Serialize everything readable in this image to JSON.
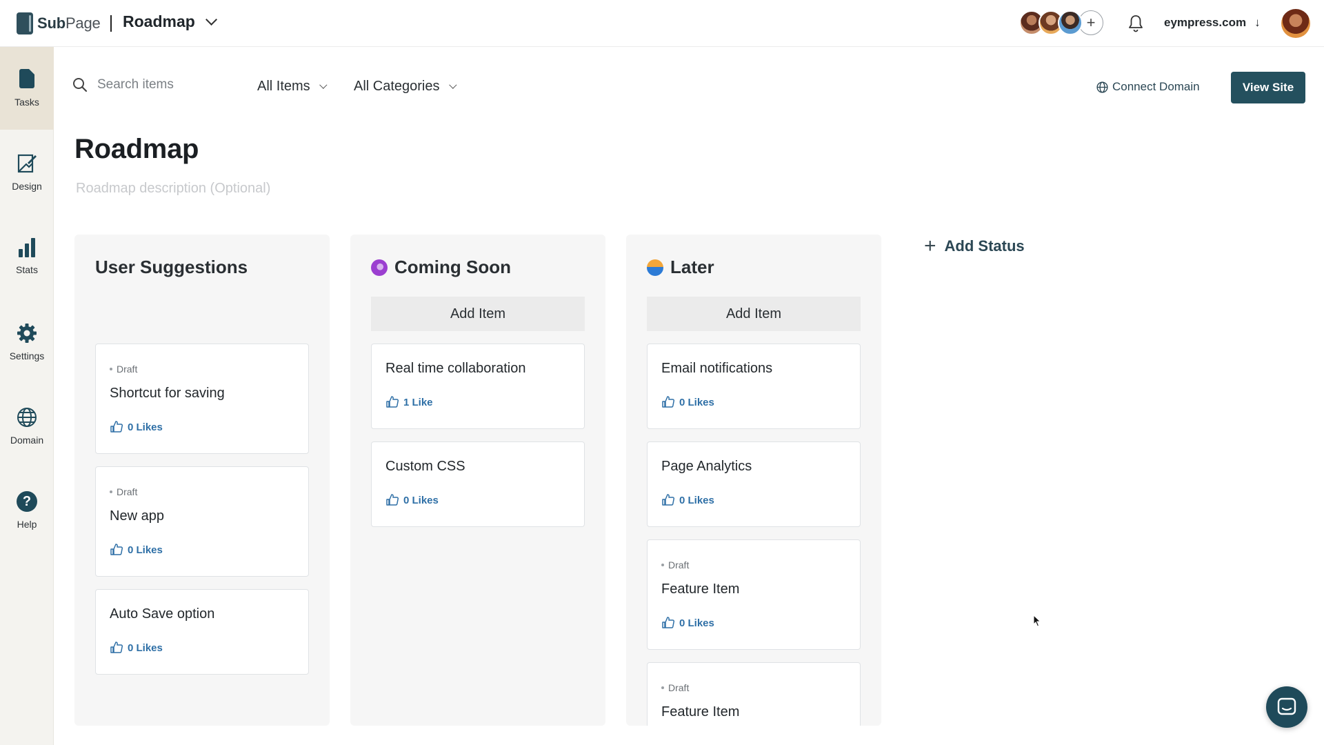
{
  "brand": {
    "name_bold": "Sub",
    "name_rest": "Page"
  },
  "header": {
    "current_page": "Roadmap",
    "domain": "eympress.com",
    "add_member": "+"
  },
  "sidebar": {
    "items": [
      {
        "label": "Tasks",
        "icon": "document-icon",
        "active": true
      },
      {
        "label": "Design",
        "icon": "design-icon"
      },
      {
        "label": "Stats",
        "icon": "stats-icon"
      },
      {
        "label": "Settings",
        "icon": "gear-icon"
      },
      {
        "label": "Domain",
        "icon": "globe-icon"
      },
      {
        "label": "Help",
        "icon": "help-icon"
      }
    ]
  },
  "toolbar": {
    "search_placeholder": "Search items",
    "filter_items": "All Items",
    "filter_categories": "All Categories",
    "connect_domain": "Connect Domain",
    "view_site": "View Site"
  },
  "page": {
    "title": "Roadmap",
    "description_placeholder": "Roadmap description (Optional)"
  },
  "board": {
    "add_status": "Add Status",
    "columns": [
      {
        "title": "User Suggestions",
        "cards": [
          {
            "status": "Draft",
            "title": "Shortcut for saving",
            "likes": "0 Likes"
          },
          {
            "status": "Draft",
            "title": "New app",
            "likes": "0 Likes"
          },
          {
            "title": "Auto Save option",
            "likes": "0 Likes"
          }
        ]
      },
      {
        "title": "Coming Soon",
        "dot_color": "#9b3fd0",
        "add_item": "Add Item",
        "cards": [
          {
            "title": "Real time collaboration",
            "likes": "1 Like"
          },
          {
            "title": "Custom CSS",
            "likes": "0 Likes"
          }
        ]
      },
      {
        "title": "Later",
        "dot_color": "#2c7bd6",
        "add_item": "Add Item",
        "cards": [
          {
            "title": "Email notifications",
            "likes": "0 Likes"
          },
          {
            "title": "Page Analytics",
            "likes": "0 Likes"
          },
          {
            "status": "Draft",
            "title": "Feature Item",
            "likes": "0 Likes"
          },
          {
            "status": "Draft",
            "title": "Feature Item"
          }
        ]
      }
    ]
  },
  "colors": {
    "primary": "#24505e",
    "accent_link": "#2e6fa6",
    "sidebar_bg": "#f4f3ef",
    "sidebar_active": "#e9e3d6"
  }
}
